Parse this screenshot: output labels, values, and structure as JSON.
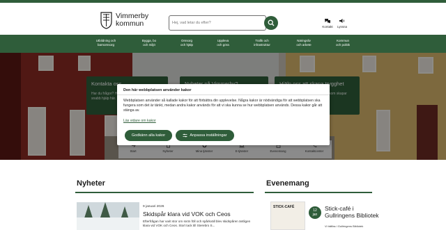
{
  "brand": {
    "name_line1": "Vimmerby",
    "name_line2": "kommun"
  },
  "search": {
    "placeholder": "Hej, vad letar du efter?"
  },
  "tools": [
    {
      "label": "Kontakt",
      "icon": "chat-icon"
    },
    {
      "label": "Lyssna",
      "icon": "speaker-icon"
    }
  ],
  "nav": [
    {
      "line1": "Utbildning och",
      "line2": "barnomsorg"
    },
    {
      "line1": "Bygga, bo",
      "line2": "och miljö"
    },
    {
      "line1": "Omsorg",
      "line2": "och hjälp"
    },
    {
      "line1": "Uppleva",
      "line2": "och göra"
    },
    {
      "line1": "Trafik och",
      "line2": "infrastruktur"
    },
    {
      "line1": "Näringsliv",
      "line2": "och arbete"
    },
    {
      "line1": "Kommun",
      "line2": "och politik"
    }
  ],
  "hero_cards": [
    {
      "title": "Kontakta oss",
      "desc1": "Har du frågor? Hör av dig till oss.",
      "desc2": "snabb hjälp här."
    },
    {
      "title": "Nyheter på Vimmerby?",
      "desc1": "",
      "desc2": ""
    },
    {
      "title": "Hjälp oss att skapa trygghet",
      "desc1": "som skapar",
      "desc2": ""
    }
  ],
  "quicklinks": [
    {
      "label": "Start",
      "icon": "arrow-icon"
    },
    {
      "label": "Nyheter",
      "icon": "document-icon"
    },
    {
      "label": "Mina tjänster",
      "icon": "plus-icon"
    },
    {
      "label": "E-tjänster",
      "icon": "laptop-icon"
    },
    {
      "label": "Evenemang",
      "icon": "calendar-icon"
    },
    {
      "label": "Kontaktcenter",
      "icon": "phone-icon"
    }
  ],
  "cookie": {
    "title": "Den här webbplatsen använder kakor",
    "body": "Webbplatsen använder så kallade kakor för att förbättra din upplevelse. Några kakor är nödvändiga för att webbplatsen ska fungera som det är tänkt, medan andra kakor används för att vi ska kunna se hur webbplatsen används. Dessa kakor går att stänga av.",
    "link": "Läs vidare om kakor",
    "accept_label": "Godkänn alla kakor",
    "customize_label": "Anpassa inställningar"
  },
  "news": {
    "heading": "Nyheter",
    "item": {
      "date": "9 januari 2026",
      "title": "Skidspår klara vid VOK och Ceos",
      "excerpt": "Efterfrågan har varit stor om snön föll och spårkväll blev skidspåren äntligen klara vid VOK och Ceos. Stort tack till Sterebro S..."
    }
  },
  "events": {
    "heading": "Evenemang",
    "item": {
      "image_text": "STICK-CAFÉ",
      "day": "12",
      "month": "jan",
      "title": "Stick-café i Gullringens Bibliotek",
      "location": "Vi träffas i Gullringens Bibliotek"
    }
  },
  "colors": {
    "primary": "#2f5d3a",
    "overlay": "rgba(0,0,0,0.42)"
  }
}
